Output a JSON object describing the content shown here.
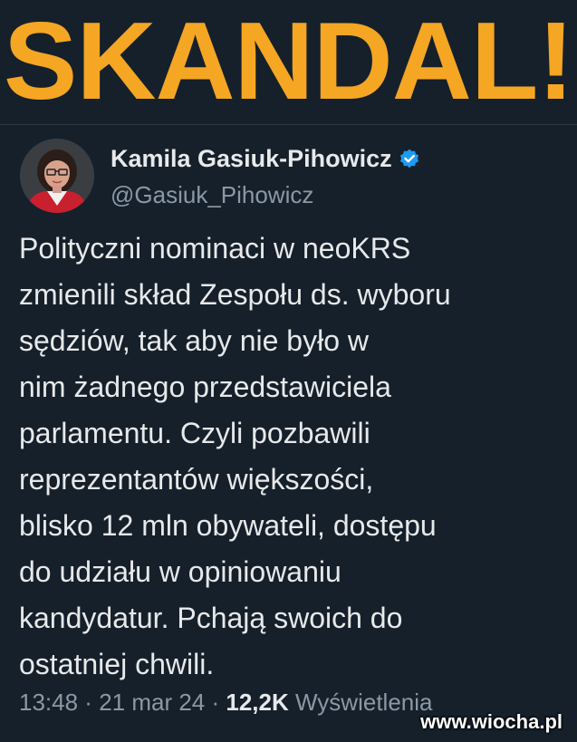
{
  "headline": "SKANDAL!",
  "tweet": {
    "author_name": "Kamila Gasiuk-Pihowicz",
    "handle": "@Gasiuk_Pihowicz",
    "verified_icon": "verified-badge-icon",
    "text_lines": [
      "Polityczni nominaci w neoKRS",
      "zmienili skład Zespołu ds. wyboru",
      "sędziów, tak aby nie było w",
      "nim żadnego przedstawiciela",
      "parlamentu. Czyli pozbawili",
      "reprezentantów większości,",
      "blisko 12 mln obywateli, dostępu",
      "do udziału w opiniowaniu",
      "kandydatur. Pchają swoich do",
      "ostatniej chwili."
    ],
    "time": "13:48",
    "date": "21 mar 24",
    "separator": " · ",
    "views_count": "12,2K",
    "views_label": "Wyświetlenia"
  },
  "watermark": "www.wiocha.pl",
  "colors": {
    "background": "#15202b",
    "headline": "#f5a623",
    "verified": "#1d9bf0",
    "muted_text": "#8b98a5",
    "main_text": "#e7e9ea"
  }
}
